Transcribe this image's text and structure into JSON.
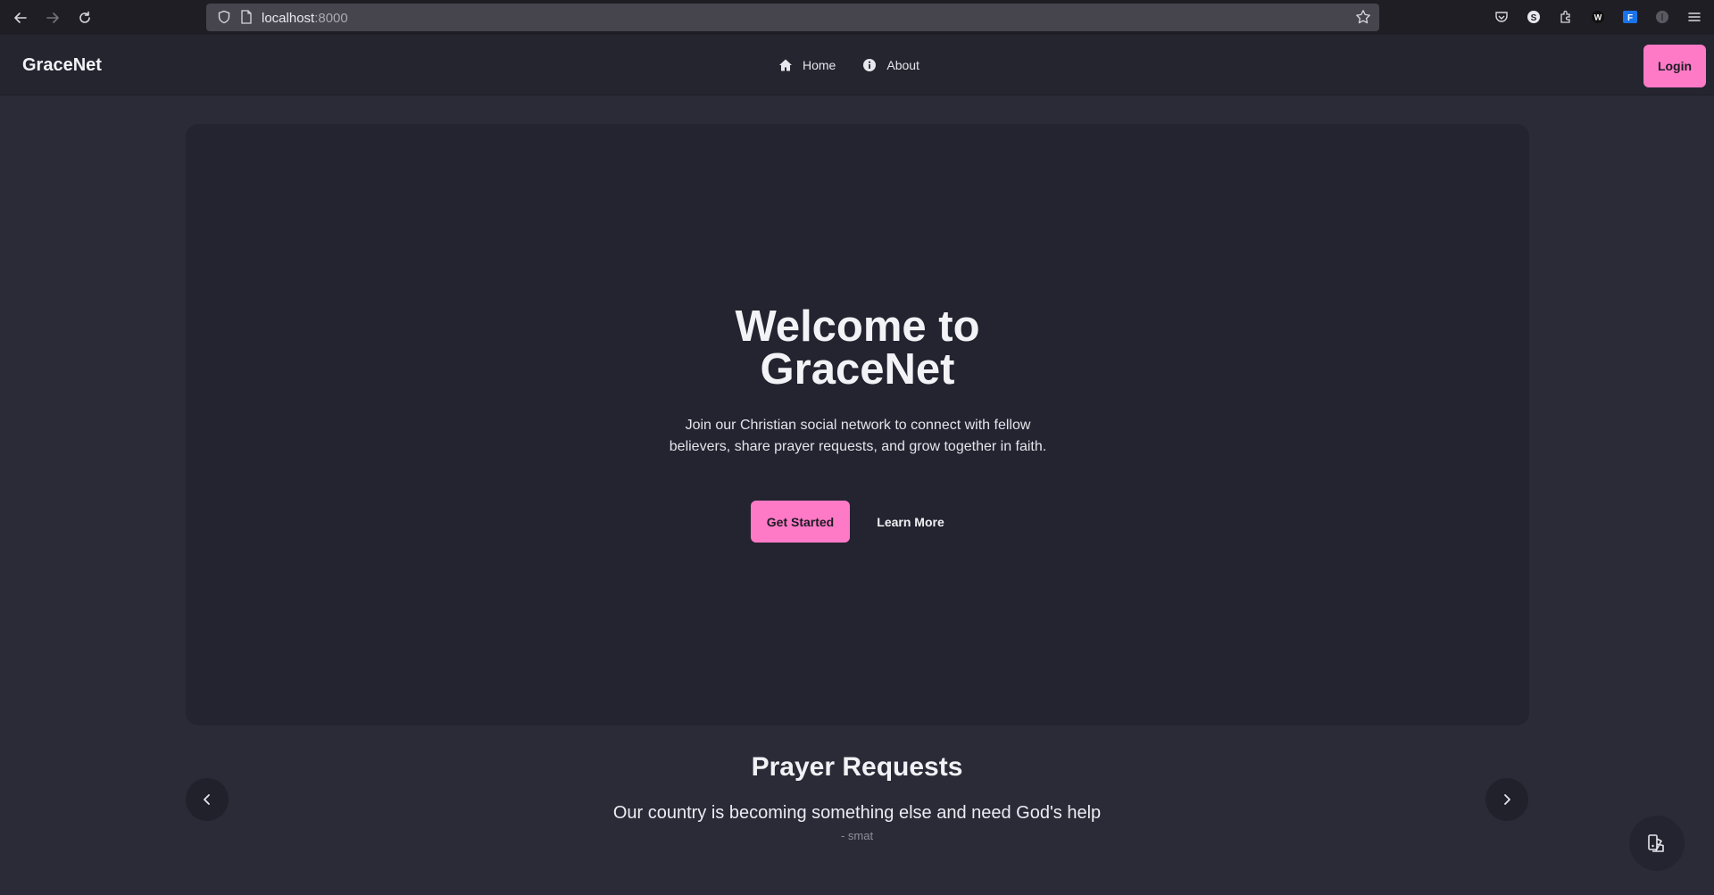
{
  "browser": {
    "url_host": "localhost",
    "url_port": ":8000",
    "icons": [
      "back-icon",
      "forward-icon",
      "reload-icon",
      "shield-icon",
      "page-icon",
      "bookmark-star-icon",
      "pocket-icon",
      "extension-s-icon",
      "extensions-icon",
      "extension-w-icon",
      "extension-f-icon",
      "extension-circle-icon",
      "menu-icon"
    ]
  },
  "nav": {
    "brand": "GraceNet",
    "links": [
      {
        "label": "Home",
        "icon": "home-icon"
      },
      {
        "label": "About",
        "icon": "info-icon"
      }
    ],
    "login_label": "Login"
  },
  "hero": {
    "title_line1": "Welcome to",
    "title_line2": "GraceNet",
    "subtitle": "Join our Christian social network to connect with fellow believers, share prayer requests, and grow together in faith.",
    "primary_button": "Get Started",
    "secondary_button": "Learn More"
  },
  "prayer": {
    "heading": "Prayer Requests",
    "request_text": "Our country is becoming something else and need God's help",
    "author": "- smat"
  },
  "colors": {
    "accent": "#ff7ac6",
    "background": "#2a2b37",
    "card": "#232430",
    "navbar": "#24252f"
  }
}
